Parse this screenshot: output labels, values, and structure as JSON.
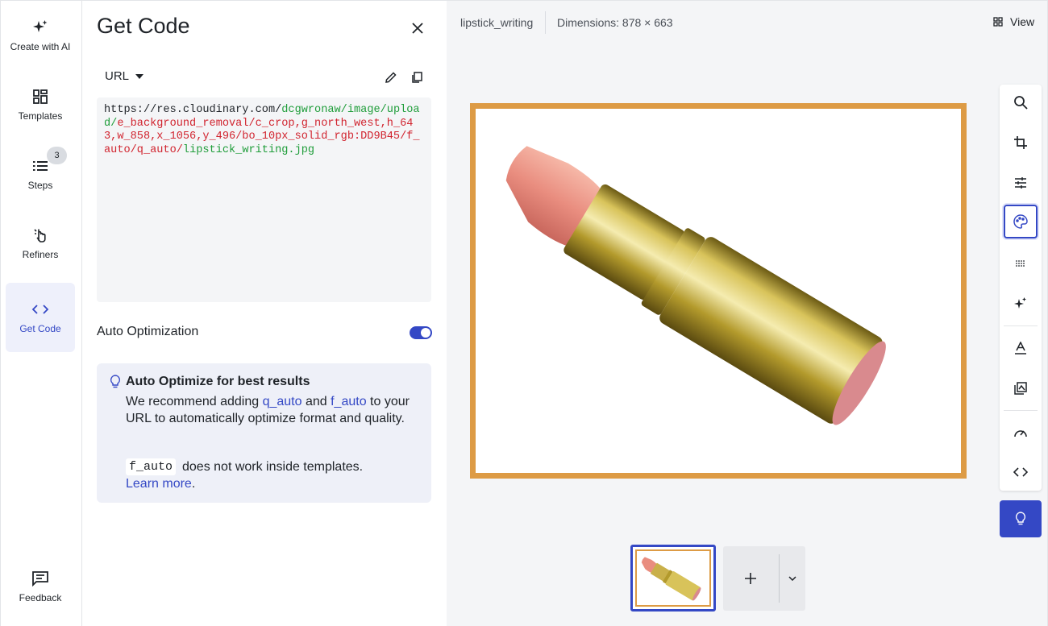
{
  "nav": {
    "items": [
      {
        "label": "Create with AI",
        "icon": "sparkle-icon"
      },
      {
        "label": "Templates",
        "icon": "grid-icon"
      },
      {
        "label": "Steps",
        "icon": "list-icon",
        "badge": "3"
      },
      {
        "label": "Refiners",
        "icon": "pointer-icon"
      },
      {
        "label": "Get Code",
        "icon": "code-icon",
        "active": true
      }
    ],
    "feedback": "Feedback"
  },
  "panel": {
    "title": "Get Code",
    "format_select": "URL",
    "code": {
      "base": "https://res.cloudinary.com/",
      "cloud": "dcgwronaw/image/",
      "upload": "upload/",
      "transform": "e_background_removal/c_crop,g_north_west,h_643,w_858,x_1056,y_496/bo_10px_solid_rgb:DD9B45/f_auto/q_auto/",
      "file": "lipstick_writing.jpg"
    },
    "auto_opt_label": "Auto Optimization",
    "auto_opt_on": true,
    "tip": {
      "title": "Auto Optimize for best results",
      "text_1": "We recommend adding ",
      "link_1": "q_auto",
      "text_2": " and ",
      "link_2": "f_auto",
      "text_3": " to your URL to automatically optimize format and quality.",
      "code": "f_auto",
      "text_4": "does not work inside templates.",
      "learn_more": "Learn more",
      "period": "."
    }
  },
  "main": {
    "file_name": "lipstick_writing",
    "dimensions": "Dimensions: 878 × 663",
    "view_label": "View",
    "border_color": "#DD9B45",
    "accent": "#3448c5",
    "toolbar_icons": [
      "search-icon",
      "crop-icon",
      "sliders-icon",
      "palette-icon",
      "dots-icon",
      "sparkle-icon",
      "text-icon",
      "layers-icon",
      "gauge-icon",
      "code-icon"
    ],
    "add_label": "+"
  }
}
